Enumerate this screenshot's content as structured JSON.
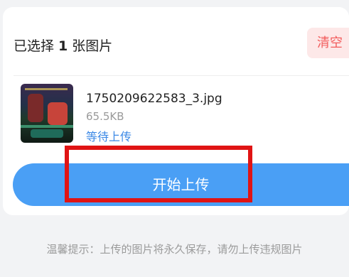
{
  "header": {
    "prefix": "已选择",
    "count": "1",
    "suffix": "张图片",
    "clear_label": "清空"
  },
  "file": {
    "name": "1750209622583_3.jpg",
    "size": "65.5KB",
    "status": "等待上传"
  },
  "upload_button_label": "开始上传",
  "tip": "温馨提示：上传的图片将永久保存，请勿上传违规图片",
  "colors": {
    "accent": "#4a9ff5",
    "status": "#3b88e6",
    "clear": "#f25c5c",
    "highlight": "#e01414"
  }
}
